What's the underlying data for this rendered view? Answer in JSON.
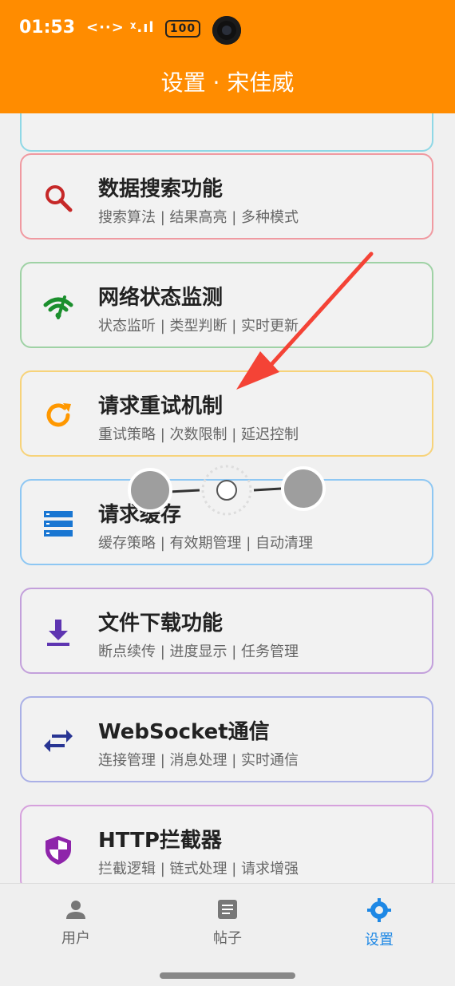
{
  "status_bar": {
    "time": "01:53",
    "signal": "<··> ᵡ.ıl",
    "battery": "100"
  },
  "app_bar": {
    "title": "设置 · 宋佳威"
  },
  "colors": {
    "brand": "#ff8c00",
    "active_tab": "#1e88e5"
  },
  "cards": [
    {
      "title": "数据搜索功能",
      "subtitle": "搜索算法 | 结果高亮 | 多种模式",
      "icon": "search-icon",
      "border": "#f09aa1",
      "icon_color": "#c62828"
    },
    {
      "title": "网络状态监测",
      "subtitle": "状态监听 | 类型判断 | 实时更新",
      "icon": "wifi-off-icon",
      "border": "#9fd2a5",
      "icon_color": "#1b8f2d"
    },
    {
      "title": "请求重试机制",
      "subtitle": "重试策略 | 次数限制 | 延迟控制",
      "icon": "refresh-icon",
      "border": "#f7d37a",
      "icon_color": "#ff9800"
    },
    {
      "title": "请求缓存",
      "subtitle": "缓存策略 | 有效期管理 | 自动清理",
      "icon": "storage-icon",
      "border": "#8ec7f3",
      "icon_color": "#1976d2"
    },
    {
      "title": "文件下载功能",
      "subtitle": "断点续传 | 进度显示 | 任务管理",
      "icon": "download-icon",
      "border": "#c3a0db",
      "icon_color": "#5e35b1"
    },
    {
      "title": "WebSocket通信",
      "subtitle": "连接管理 | 消息处理 | 实时通信",
      "icon": "swap-icon",
      "border": "#aab0e6",
      "icon_color": "#283593"
    },
    {
      "title": "HTTP拦截器",
      "subtitle": "拦截逻辑 | 链式处理 | 请求增强",
      "icon": "shield-icon",
      "border": "#d6a1dd",
      "icon_color": "#8e24aa"
    }
  ],
  "bottom_nav": [
    {
      "label": "用户",
      "icon": "person-icon"
    },
    {
      "label": "帖子",
      "icon": "article-icon"
    },
    {
      "label": "设置",
      "icon": "gear-icon",
      "active": true
    }
  ]
}
